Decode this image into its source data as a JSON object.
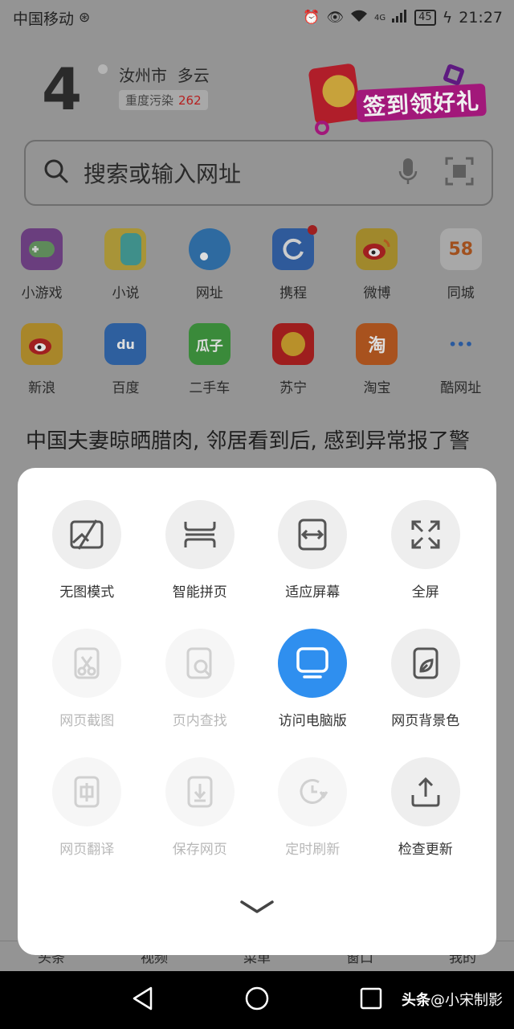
{
  "status_bar": {
    "carrier": "中国移动",
    "network": "4G",
    "battery": "45",
    "time": "21:27"
  },
  "weather": {
    "temperature": "4",
    "city": "汝州市",
    "condition": "多云",
    "aqi_label": "重度污染",
    "aqi_value": "262"
  },
  "promo": {
    "text": "签到领好礼"
  },
  "search": {
    "placeholder": "搜索或输入网址"
  },
  "shortcuts": {
    "row1": [
      {
        "label": "小游戏",
        "icon": "game-icon"
      },
      {
        "label": "小说",
        "icon": "novel-icon"
      },
      {
        "label": "网址",
        "icon": "url-icon"
      },
      {
        "label": "携程",
        "icon": "ctrip-icon",
        "badge": true
      },
      {
        "label": "微博",
        "icon": "weibo-icon"
      },
      {
        "label": "同城",
        "icon": "58-icon",
        "glyph": "58"
      }
    ],
    "row2": [
      {
        "label": "新浪",
        "icon": "sina-icon"
      },
      {
        "label": "百度",
        "icon": "baidu-icon",
        "glyph": "du"
      },
      {
        "label": "二手车",
        "icon": "guazi-icon",
        "glyph": "瓜子"
      },
      {
        "label": "苏宁",
        "icon": "suning-icon"
      },
      {
        "label": "淘宝",
        "icon": "taobao-icon",
        "glyph": "淘"
      },
      {
        "label": "酷网址",
        "icon": "more-icon",
        "glyph": "•••"
      }
    ]
  },
  "headline": "中国夫妻晾晒腊肉, 邻居看到后, 感到异常报了警",
  "bottom_nav": [
    "头条",
    "视频",
    "菜单",
    "窗口",
    "我的"
  ],
  "sheet": {
    "row1": [
      {
        "label": "无图模式",
        "icon": "no-image-icon",
        "state": "normal"
      },
      {
        "label": "智能拼页",
        "icon": "page-merge-icon",
        "state": "normal"
      },
      {
        "label": "适应屏幕",
        "icon": "fit-screen-icon",
        "state": "normal"
      },
      {
        "label": "全屏",
        "icon": "fullscreen-icon",
        "state": "normal"
      }
    ],
    "row2": [
      {
        "label": "网页截图",
        "icon": "screenshot-icon",
        "state": "disabled"
      },
      {
        "label": "页内查找",
        "icon": "find-in-page-icon",
        "state": "disabled"
      },
      {
        "label": "访问电脑版",
        "icon": "desktop-icon",
        "state": "active"
      },
      {
        "label": "网页背景色",
        "icon": "background-color-icon",
        "state": "normal"
      }
    ],
    "row3": [
      {
        "label": "网页翻译",
        "icon": "translate-icon",
        "state": "disabled"
      },
      {
        "label": "保存网页",
        "icon": "save-page-icon",
        "state": "disabled"
      },
      {
        "label": "定时刷新",
        "icon": "timed-refresh-icon",
        "state": "disabled"
      },
      {
        "label": "检查更新",
        "icon": "check-update-icon",
        "state": "normal"
      }
    ]
  },
  "watermark": {
    "brand": "头条",
    "author": "@小宋制影"
  },
  "colors": {
    "active_blue": "#2f8fef",
    "overlay_gray": "#949494",
    "sheet_bg": "#ffffff"
  }
}
